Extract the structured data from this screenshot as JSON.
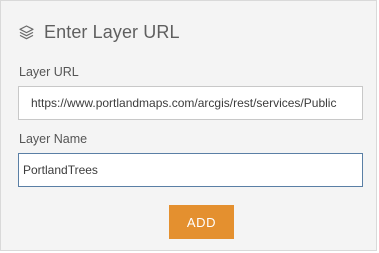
{
  "header": {
    "icon": "layers-icon",
    "title": "Enter Layer URL"
  },
  "form": {
    "url_label": "Layer URL",
    "url_value": "https://www.portlandmaps.com/arcgis/rest/services/Public",
    "name_label": "Layer Name",
    "name_value": "PortlandTrees",
    "add_label": "ADD"
  },
  "colors": {
    "panel_background": "#f4f4f4",
    "accent_button": "#e4902f",
    "focused_border": "#5a7fa5"
  }
}
